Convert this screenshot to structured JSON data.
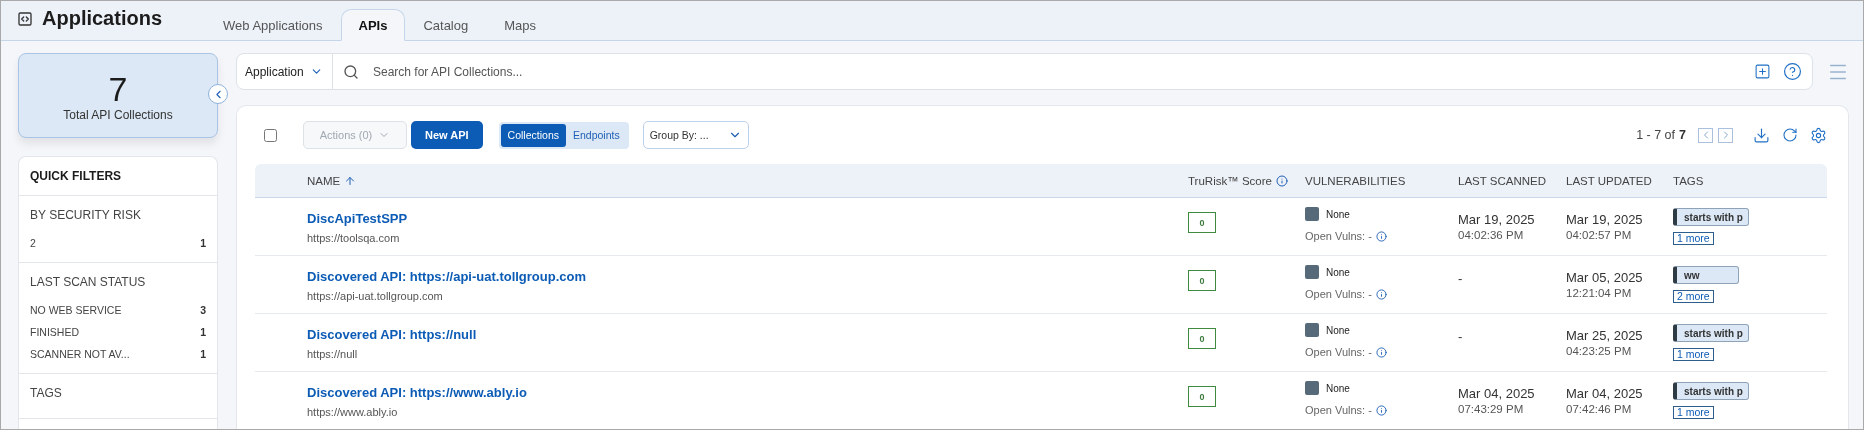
{
  "header": {
    "title": "Applications"
  },
  "tabs": [
    {
      "label": "Web Applications",
      "selected": false
    },
    {
      "label": "APIs",
      "selected": true
    },
    {
      "label": "Catalog",
      "selected": false
    },
    {
      "label": "Maps",
      "selected": false
    }
  ],
  "summary": {
    "count": "7",
    "label": "Total API Collections"
  },
  "quick_filters": {
    "title": "QUICK FILTERS",
    "groups": [
      {
        "title": "BY SECURITY RISK",
        "items": [
          {
            "label": "2",
            "count": "1"
          }
        ]
      },
      {
        "title": "LAST SCAN STATUS",
        "items": [
          {
            "label": "NO WEB SERVICE",
            "count": "3"
          },
          {
            "label": "FINISHED",
            "count": "1"
          },
          {
            "label": "SCANNER NOT AV...",
            "count": "1"
          }
        ]
      },
      {
        "title": "TAGS"
      }
    ]
  },
  "search": {
    "scope": "Application",
    "placeholder": "Search for API Collections..."
  },
  "toolbar": {
    "select_all": {
      "checked": false
    },
    "actions": {
      "label": "Actions (0)",
      "disabled": true
    },
    "new_button": "New API",
    "view_toggle": [
      {
        "label": "Collections",
        "selected": true
      },
      {
        "label": "Endpoints",
        "selected": false
      }
    ],
    "group_by": "Group By: ...",
    "pagination": {
      "range": "1 - 7 of",
      "total": "7"
    }
  },
  "table": {
    "columns": [
      {
        "label": "NAME",
        "sorted_ascending": true
      },
      {
        "label": "TruRisk™ Score",
        "info": true
      },
      {
        "label": "VULNERABILITIES"
      },
      {
        "label": "LAST SCANNED"
      },
      {
        "label": "LAST UPDATED"
      },
      {
        "label": "TAGS"
      }
    ],
    "rows": [
      {
        "name": "DiscApiTestSPP",
        "url": "https://toolsqa.com",
        "score": "0",
        "severity": "None",
        "open_vulns": "Open Vulns: -",
        "last_scanned": {
          "date": "Mar 19, 2025",
          "time": "04:02:36 PM"
        },
        "last_updated": {
          "date": "Mar 19, 2025",
          "time": "04:02:57 PM"
        },
        "tag": "starts with p",
        "more": "1 more"
      },
      {
        "name": "Discovered API: https://api-uat.tollgroup.com",
        "url": "https://api-uat.tollgroup.com",
        "score": "0",
        "severity": "None",
        "open_vulns": "Open Vulns: -",
        "last_scanned": {
          "date": "-"
        },
        "last_updated": {
          "date": "Mar 05, 2025",
          "time": "12:21:04 PM"
        },
        "tag": "ww",
        "more": "2 more"
      },
      {
        "name": "Discovered API: https://null",
        "url": "https://null",
        "score": "0",
        "severity": "None",
        "open_vulns": "Open Vulns: -",
        "last_scanned": {
          "date": "-"
        },
        "last_updated": {
          "date": "Mar 25, 2025",
          "time": "04:23:25 PM"
        },
        "tag": "starts with p",
        "more": "1 more"
      },
      {
        "name": "Discovered API: https://www.ably.io",
        "url": "https://www.ably.io",
        "score": "0",
        "severity": "None",
        "open_vulns": "Open Vulns: -",
        "last_scanned": {
          "date": "Mar 04, 2025",
          "time": "07:43:29 PM"
        },
        "last_updated": {
          "date": "Mar 04, 2025",
          "time": "07:42:46 PM"
        },
        "tag": "starts with p",
        "more": "1 more"
      }
    ]
  }
}
